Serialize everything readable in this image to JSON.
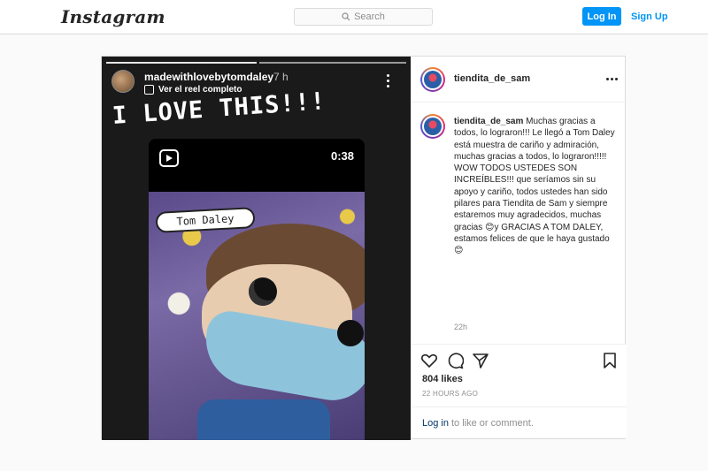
{
  "nav": {
    "logo": "Instagram",
    "search_placeholder": "Search",
    "login_label": "Log In",
    "signup_label": "Sign Up"
  },
  "story": {
    "username": "madewithlovebytomdaley",
    "time": "7 h",
    "reel_link": "Ver el reel completo",
    "headline": "I LOVE THIS!!!",
    "reel_duration": "0:38",
    "name_tag": "Tom Daley"
  },
  "post": {
    "username": "tiendita_de_sam",
    "caption_username": "tiendita_de_sam",
    "caption": "Muchas gracias a todos, lo lograron!!! Le llegó a Tom Daley está muestra de cariño y admiración, muchas gracias a todos, lo lograron!!!!! WOW TODOS USTEDES SON INCREÍBLES!!! que seríamos sin su apoyo y cariño, todos ustedes han sido pilares para Tiendita de Sam y siempre estaremos muy agradecidos, muchas gracias 😊y GRACIAS A TOM DALEY, estamos felices de que le haya gustado 😊",
    "caption_time": "22h",
    "likes": "804 likes",
    "date": "22 HOURS AGO",
    "login_link": "Log in",
    "comment_prompt": "to like or comment."
  },
  "colors": {
    "accent": "#0095f6",
    "text": "#262626",
    "muted": "#8e8e8e",
    "border": "#dbdbdb"
  }
}
